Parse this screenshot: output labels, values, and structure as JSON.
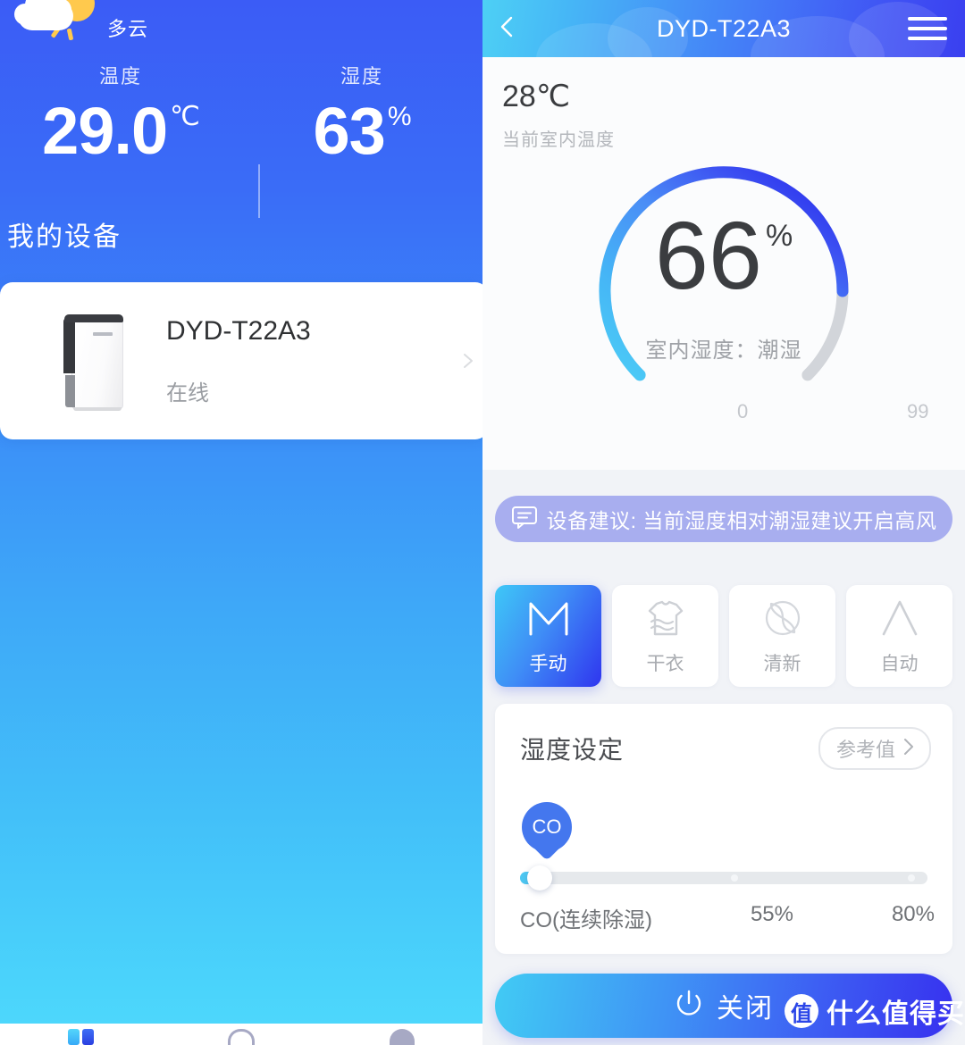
{
  "home": {
    "weather": {
      "icon": "partly-cloudy-icon",
      "label": "多云"
    },
    "readings": [
      {
        "label": "温度",
        "value": "29.0",
        "unit": "℃"
      },
      {
        "label": "湿度",
        "value": "63",
        "unit": "%"
      }
    ],
    "section_title": "我的设备",
    "device": {
      "name": "DYD-T22A3",
      "status": "在线",
      "thumb_icon": "dehumidifier-image",
      "chevron_icon": "chevron-right-icon"
    },
    "bottom_nav": [
      {
        "label": "",
        "icon": "grid-device-icon"
      },
      {
        "label": "",
        "icon": "shopping-bag-icon"
      },
      {
        "label": "",
        "icon": "profile-avatar-icon"
      }
    ]
  },
  "detail": {
    "header": {
      "back_icon": "chevron-left-icon",
      "title": "DYD-T22A3",
      "menu_icon": "hamburger-menu-icon"
    },
    "indoor": {
      "temperature": "28℃",
      "temperature_caption": "当前室内温度"
    },
    "gauge": {
      "value": "66",
      "unit": "%",
      "caption": "室内湿度：潮湿",
      "scale_min": "0",
      "scale_max": "99"
    },
    "advice": {
      "icon": "message-tip-icon",
      "text": "设备建议: 当前湿度相对潮湿建议开启高风"
    },
    "modes": [
      {
        "label": "手动",
        "icon": "manual-m-icon",
        "active": true
      },
      {
        "label": "干衣",
        "icon": "dry-clothes-icon",
        "active": false
      },
      {
        "label": "清新",
        "icon": "fresh-leaf-icon",
        "active": false
      },
      {
        "label": "自动",
        "icon": "auto-a-icon",
        "active": false
      }
    ],
    "humidity": {
      "title": "湿度设定",
      "reference_label": "参考值",
      "reference_icon": "chevron-right-icon",
      "pin_label": "CO",
      "ticks": [
        "CO(连续除湿)",
        "55%",
        "80%"
      ]
    },
    "power": {
      "icon": "power-icon",
      "label": "关闭"
    }
  },
  "watermark": {
    "badge": "值",
    "text": "什么值得买"
  },
  "colors": {
    "brand_blue": "#3b5cf6",
    "brand_cyan": "#4dd0f5",
    "accent_indigo": "#2f35ef",
    "advice_bg": "#a8aeef",
    "gauge_track": "#d2d5da",
    "slider_fill": "#4cc8f3"
  },
  "chart_data": {
    "type": "gauge",
    "title": "室内湿度",
    "value": 66,
    "unit": "%",
    "min": 0,
    "max": 99,
    "status_label": "潮湿",
    "arc_start_deg": 135,
    "arc_sweep_deg": 270,
    "filled_fraction": 0.667,
    "colors": {
      "start": "#4cc8f3",
      "end": "#2f35ef",
      "track": "#d2d5da"
    }
  }
}
